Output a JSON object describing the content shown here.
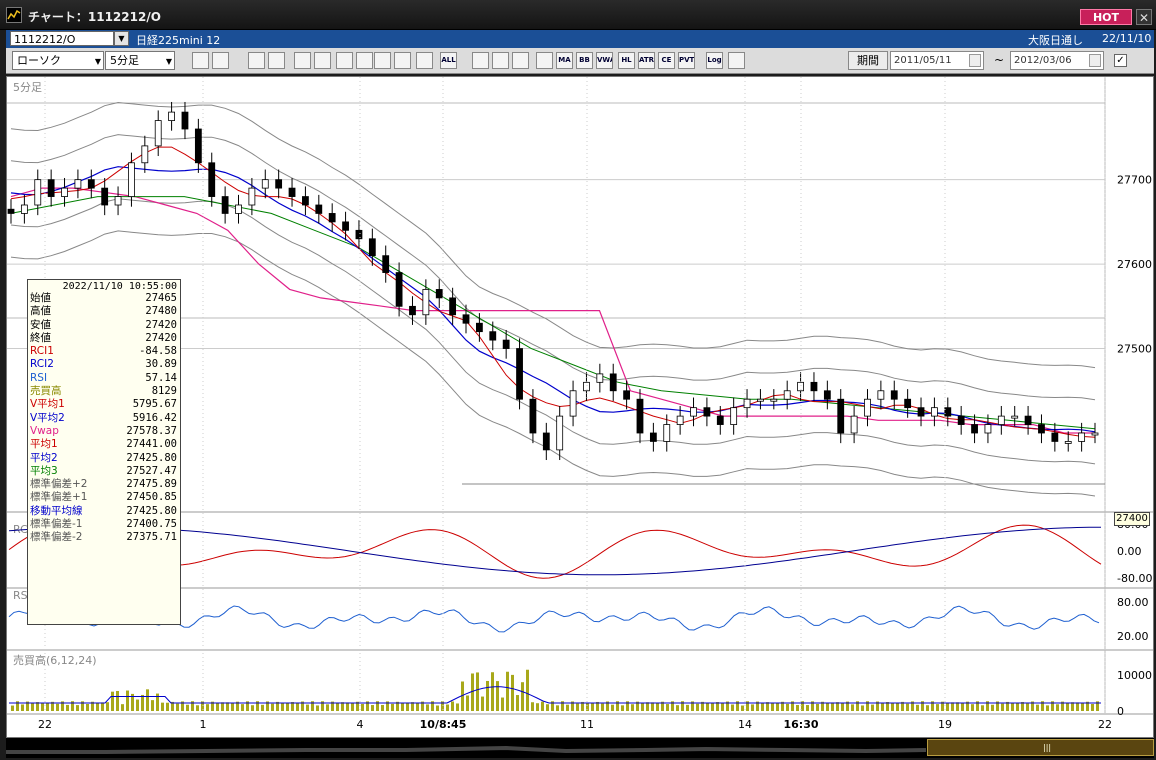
{
  "window": {
    "title": "チャート：1112212/O",
    "hot_label": "HOT",
    "close_label": "✕"
  },
  "symbol_bar": {
    "code": "1112212/O",
    "name": "日経225mini 12",
    "session": "大阪日通し",
    "date": "22/11/10"
  },
  "toolbar": {
    "chart_type": "ローソク",
    "interval": "5分足",
    "icons": [
      "search-icon",
      "crosshair-icon",
      "zoom-icon",
      "quick-icon",
      "candlestick-icon",
      "alert-icon",
      "pen-icon",
      "cursor-icon",
      "undo-icon",
      "candle-select-icon",
      "bar-select-icon",
      "all-icon",
      "fill-icon",
      "brush-icon",
      "color-icon",
      "table-icon",
      "ma-icon",
      "bb-icon",
      "vwap-icon",
      "hl-icon",
      "atr-icon",
      "ce-icon",
      "pvt-icon",
      "log-icon",
      "export-icon"
    ],
    "icon_labels": [
      "",
      "",
      "",
      "",
      "",
      "",
      "",
      "",
      "",
      "",
      "",
      "ALL",
      "",
      "",
      "",
      "",
      "MA",
      "BB",
      "VWAP",
      "HL",
      "ATR",
      "CE",
      "PVT",
      "Log",
      ""
    ],
    "period_label": "期間",
    "date_from": "2011/05/11",
    "date_to": "2012/03/06",
    "tilde": "~",
    "apply_check": "✓"
  },
  "panes": {
    "main_label": "5分足",
    "rci_label": "RCI",
    "rsi_label": "RSI(14)",
    "volume_label": "売買高(6,12,24)",
    "current_price_tag": "27400"
  },
  "data_window": {
    "timestamp": "2022/11/10 10:55:00",
    "rows": [
      {
        "label": "始値",
        "value": "27465",
        "color": "#000000"
      },
      {
        "label": "高値",
        "value": "27480",
        "color": "#000000"
      },
      {
        "label": "安値",
        "value": "27420",
        "color": "#000000"
      },
      {
        "label": "終値",
        "value": "27420",
        "color": "#000000"
      },
      {
        "label": "RCI1",
        "value": "-84.58",
        "color": "#cc0000"
      },
      {
        "label": "RCI2",
        "value": "30.89",
        "color": "#0000cc"
      },
      {
        "label": "RSI",
        "value": "57.14",
        "color": "#1e5fd0"
      },
      {
        "label": "売買高",
        "value": "8129",
        "color": "#8a8a00"
      },
      {
        "label": "V平均1",
        "value": "5795.67",
        "color": "#cc0000"
      },
      {
        "label": "V平均2",
        "value": "5916.42",
        "color": "#0000cc"
      },
      {
        "label": "Vwap",
        "value": "27578.37",
        "color": "#e0208a"
      },
      {
        "label": "平均1",
        "value": "27441.00",
        "color": "#cc0000"
      },
      {
        "label": "平均2",
        "value": "27425.80",
        "color": "#0000cc"
      },
      {
        "label": "平均3",
        "value": "27527.47",
        "color": "#008000"
      },
      {
        "label": "標準偏差+2",
        "value": "27475.89",
        "color": "#555555"
      },
      {
        "label": "標準偏差+1",
        "value": "27450.85",
        "color": "#555555"
      },
      {
        "label": "移動平均線",
        "value": "27425.80",
        "color": "#0000cc"
      },
      {
        "label": "標準偏差-1",
        "value": "27400.75",
        "color": "#555555"
      },
      {
        "label": "標準偏差-2",
        "value": "27375.71",
        "color": "#555555"
      }
    ]
  },
  "chart_data": {
    "type": "candlestick",
    "price_axis": {
      "ticks": [
        "27700",
        "27600",
        "27500"
      ],
      "range": [
        27310,
        27805
      ]
    },
    "rci_axis": {
      "ticks": [
        "80.00",
        "0.00",
        "-80.00"
      ],
      "range": [
        -100,
        100
      ]
    },
    "rsi_axis": {
      "ticks": [
        "80.00",
        "20.00"
      ],
      "range": [
        0,
        100
      ]
    },
    "volume_axis": {
      "ticks": [
        "10000",
        "0"
      ],
      "range": [
        0,
        16000
      ]
    },
    "x_ticks": [
      {
        "label": "22",
        "bold": false
      },
      {
        "label": "1",
        "bold": false
      },
      {
        "label": "4",
        "bold": false
      },
      {
        "label": "10/8:45",
        "bold": true
      },
      {
        "label": "11",
        "bold": false
      },
      {
        "label": "14",
        "bold": false
      },
      {
        "label": "16:30",
        "bold": true
      },
      {
        "label": "19",
        "bold": false
      },
      {
        "label": "22",
        "bold": false
      }
    ],
    "close_path": [
      27660,
      27670,
      27700,
      27680,
      27690,
      27700,
      27690,
      27670,
      27680,
      27720,
      27740,
      27770,
      27780,
      27760,
      27720,
      27680,
      27660,
      27670,
      27690,
      27700,
      27690,
      27680,
      27670,
      27660,
      27650,
      27640,
      27630,
      27610,
      27590,
      27550,
      27540,
      27570,
      27560,
      27540,
      27530,
      27520,
      27510,
      27500,
      27440,
      27400,
      27380,
      27420,
      27450,
      27460,
      27470,
      27450,
      27440,
      27400,
      27390,
      27410,
      27420,
      27430,
      27420,
      27410,
      27430,
      27440,
      27440,
      27440,
      27450,
      27460,
      27450,
      27440,
      27400,
      27420,
      27440,
      27450,
      27440,
      27430,
      27420,
      27430,
      27420,
      27410,
      27400,
      27410,
      27420,
      27420,
      27410,
      27400,
      27390,
      27390,
      27400,
      27400
    ],
    "vwap_path": [
      27680,
      27690,
      27690,
      27685,
      27680,
      27670,
      27660,
      27640,
      27600,
      27570,
      27560,
      27555,
      27550,
      27545,
      27545,
      27545,
      27545,
      27545,
      27545,
      27545,
      27450,
      27440,
      27430,
      27420,
      27420,
      27420,
      27420,
      27420,
      27415,
      27415,
      27415,
      27410,
      27410,
      27410,
      27400,
      27400
    ],
    "ma3_path": [
      27660,
      27670,
      27680,
      27680,
      27680,
      27670,
      27660,
      27640,
      27620,
      27590,
      27560,
      27530,
      27500,
      27480,
      27460,
      27450,
      27445,
      27440,
      27440,
      27435,
      27430,
      27425,
      27420,
      27415,
      27410,
      27405
    ]
  },
  "colors": {
    "ma1": "#cc0000",
    "ma2": "#0000cc",
    "ma3": "#008000",
    "vwap": "#e0208a",
    "band": "#888888",
    "candle_up": "#ffffff",
    "candle_down": "#000000",
    "rci1": "#cc0000",
    "rci2": "#000090",
    "rsi": "#1e5fd0",
    "volume": "#a8a81a"
  }
}
